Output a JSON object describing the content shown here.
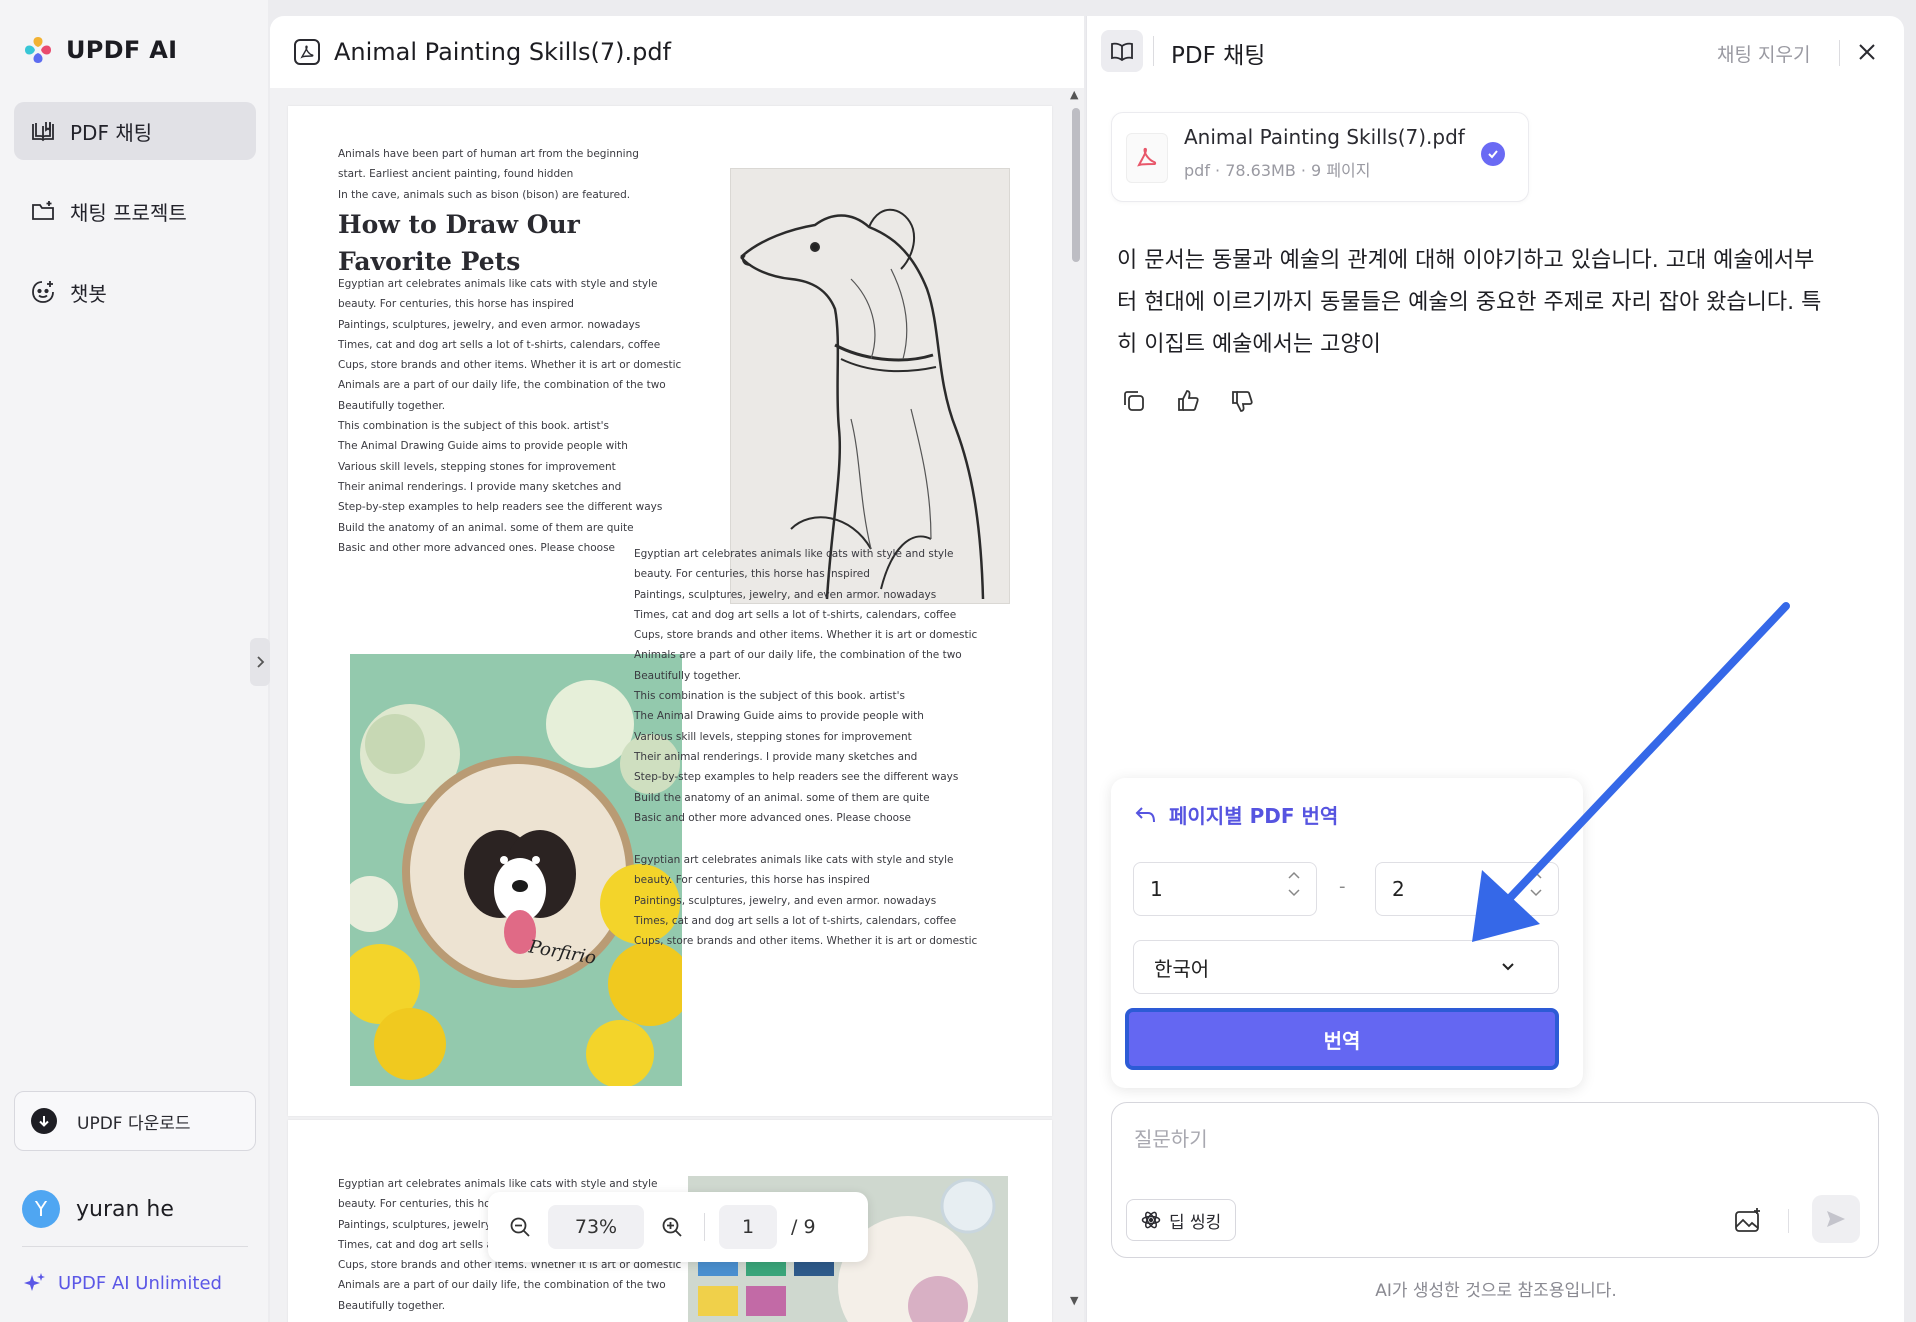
{
  "sidebar": {
    "brand": "UPDF AI",
    "items": [
      {
        "label": "PDF 채팅",
        "icon": "book-open-icon",
        "active": true
      },
      {
        "label": "채팅 프로젝트",
        "icon": "folder-plus-icon",
        "active": false
      },
      {
        "label": "챗봇",
        "icon": "bot-face-icon",
        "active": false
      }
    ],
    "download_label": "UPDF 다운로드",
    "user": {
      "initial": "Y",
      "name": "yuran he"
    },
    "unlimited_label": "UPDF AI Unlimited"
  },
  "viewer": {
    "file_title": "Animal Painting Skills(7).pdf",
    "zoom": "73%",
    "current_page": "1",
    "total_pages": "/ 9",
    "page1": {
      "intro": [
        "Animals have been part of human art from the beginning",
        "start. Earliest ancient painting, found hidden",
        "In the cave, animals such as bison (bison) are featured."
      ],
      "heading": [
        "How to Draw Our",
        "Favorite Pets"
      ],
      "body1": [
        "Egyptian art celebrates animals like cats with style and style",
        "beauty. For centuries, this horse has inspired",
        "Paintings, sculptures, jewelry, and even armor. nowadays",
        "Times, cat and dog art sells a lot of t-shirts, calendars, coffee",
        "Cups, store brands and other items. Whether it is art or domestic",
        "Animals are a part of our daily life, the combination of the two",
        "Beautifully together.",
        "This combination is the subject of this book. artist's",
        "The Animal Drawing Guide aims to provide people with",
        "Various skill levels, stepping stones for improvement",
        "Their animal renderings. I provide many sketches and",
        "Step-by-step examples to help readers see the different ways",
        "Build the anatomy of an animal. some of them are quite",
        "Basic and other more advanced ones. Please choose"
      ],
      "body2": [
        "Egyptian art celebrates animals like cats with style and style",
        "beauty. For centuries, this horse has inspired",
        "Paintings, sculptures, jewelry, and even armor. nowadays",
        "Times, cat and dog art sells a lot of t-shirts, calendars, coffee",
        "Cups, store brands and other items. Whether it is art or domestic",
        "Animals are a part of our daily life, the combination of the two",
        "Beautifully together.",
        "This combination is the subject of this book. artist's",
        "The Animal Drawing Guide aims to provide people with",
        "Various skill levels, stepping stones for improvement",
        "Their animal renderings. I provide many sketches and",
        "Step-by-step examples to help readers see the different ways",
        "Build the anatomy of an animal. some of them are quite",
        "Basic and other more advanced ones. Please choose"
      ],
      "body3": [
        "Egyptian art celebrates animals like cats with style and style",
        "beauty. For centuries, this horse has inspired",
        "Paintings, sculptures, jewelry, and even armor. nowadays",
        "Times, cat and dog art sells a lot of t-shirts, calendars, coffee",
        "Cups, store brands and other items. Whether it is art or domestic"
      ],
      "embroidery_caption": "Porfirio"
    },
    "page2": {
      "body": [
        "Egyptian art celebrates animals like cats with style and style",
        "beauty. For centuries, this hors",
        "Paintings, sculptures, jewelry,",
        "Times, cat and dog art sells a lo",
        "Cups, store brands and other items. Whether it is art or domestic",
        "Animals are a part of our daily life, the combination of the two",
        "Beautifully together."
      ]
    }
  },
  "chat": {
    "title": "PDF 채팅",
    "clear_label": "채팅 지우기",
    "file_card": {
      "name": "Animal Painting Skills(7).pdf",
      "meta": "pdf · 78.63MB · 9 페이지"
    },
    "answer_lines": [
      "이 문서는 동물과 예술의 관계에 대해 이야기하고 있습니다. 고대 예술에서부",
      "터 현대에 이르기까지 동물들은 예술의 중요한 주제로 자리 잡아 왔습니다. 특",
      "히 이집트 예술에서는 고양이"
    ],
    "translate": {
      "title": "페이지별 PDF 번역",
      "from_page": "1",
      "to_page": "2",
      "dash": "-",
      "language": "한국어",
      "button": "번역"
    },
    "input": {
      "placeholder": "질문하기",
      "deep_think": "딥 씽킹"
    },
    "disclaimer": "AI가 생성한 것으로 참조용입니다."
  },
  "colors": {
    "accent": "#6467f2",
    "accent_text": "#5654e0",
    "annotation_arrow": "#3568e8"
  }
}
